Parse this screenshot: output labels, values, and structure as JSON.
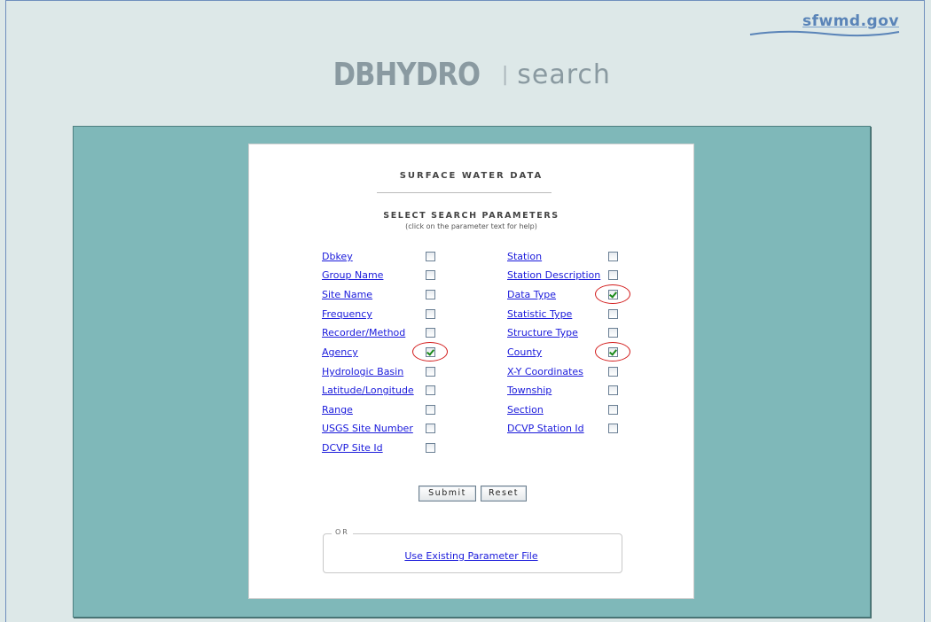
{
  "header": {
    "logo_text": "sfwmd.gov",
    "brand": "DBHYDRO",
    "separator": "|",
    "subtitle": "search"
  },
  "form": {
    "title": "SURFACE WATER DATA",
    "subtitle": "SELECT SEARCH PARAMETERS",
    "help": "(click on the parameter text for help)",
    "left_params": [
      {
        "label": "Dbkey",
        "checked": false
      },
      {
        "label": "Group Name",
        "checked": false
      },
      {
        "label": "Site Name",
        "checked": false
      },
      {
        "label": "Frequency",
        "checked": false
      },
      {
        "label": "Recorder/Method",
        "checked": false
      },
      {
        "label": "Agency",
        "checked": true
      },
      {
        "label": "Hydrologic Basin",
        "checked": false
      },
      {
        "label": "Latitude/Longitude",
        "checked": false
      },
      {
        "label": "Range",
        "checked": false
      },
      {
        "label": "USGS Site Number",
        "checked": false
      },
      {
        "label": "DCVP Site Id",
        "checked": false
      }
    ],
    "right_params": [
      {
        "label": "Station",
        "checked": false
      },
      {
        "label": "Station Description",
        "checked": false
      },
      {
        "label": "Data Type",
        "checked": true
      },
      {
        "label": "Statistic Type",
        "checked": false
      },
      {
        "label": "Structure Type",
        "checked": false
      },
      {
        "label": "County",
        "checked": true
      },
      {
        "label": "X-Y Coordinates",
        "checked": false
      },
      {
        "label": "Township",
        "checked": false
      },
      {
        "label": "Section",
        "checked": false
      },
      {
        "label": "DCVP Station Id",
        "checked": false
      }
    ],
    "submit_label": "Submit",
    "reset_label": "Reset",
    "or_label": "OR",
    "existing_link": "Use Existing Parameter File"
  },
  "colors": {
    "page_bg": "#dde8e8",
    "panel_bg": "#7fb8b9",
    "link": "#1a1adb",
    "highlight_circle": "#d21a1a"
  }
}
